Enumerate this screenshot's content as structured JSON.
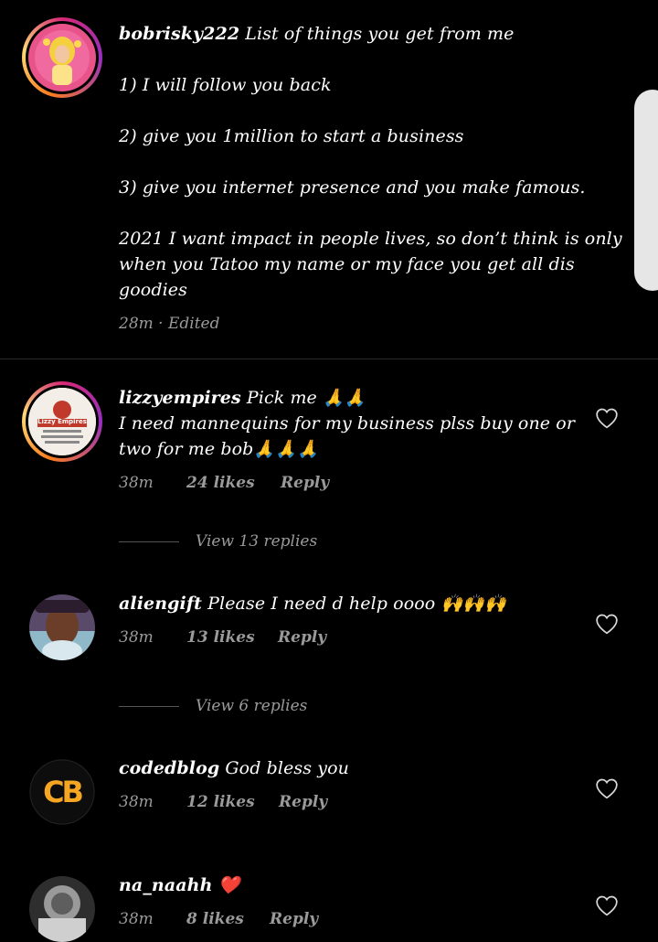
{
  "main_comment": {
    "username": "bobrisky222",
    "first_line": "List of things you get from me",
    "lines": [
      "1) I will follow you back",
      "2) give you 1million to start a business",
      "3) give you internet presence and you make famous.",
      "2021 I want impact in people lives, so don’t think is only",
      "when you Tatoo my name or my face you get all dis",
      "goodies"
    ],
    "meta": "28m · Edited"
  },
  "comments": [
    {
      "username": "lizzyempires",
      "text_line1": "Pick me 🙏🙏",
      "text_line2": "I need mannequins for my business plss buy one or",
      "text_line3": "two for me bob🙏🙏🙏",
      "time": "38m",
      "likes": "24 likes",
      "reply": "Reply",
      "view_replies": "View 13 replies",
      "avatar_text": "Lizzy Empires"
    },
    {
      "username": "aliengift",
      "text": "Please I need d help oooo 🙌🙌🙌",
      "time": "38m",
      "likes": "13 likes",
      "reply": "Reply",
      "view_replies": "View 6 replies"
    },
    {
      "username": "codedblog",
      "text": "God bless you",
      "time": "38m",
      "likes": "12 likes",
      "reply": "Reply",
      "avatar_text": "CB"
    },
    {
      "username": "na_naahh",
      "text": "❤️",
      "time": "38m",
      "likes": "8 likes",
      "reply": "Reply"
    }
  ],
  "colors": {
    "background": "#000000",
    "text": "#ffffff",
    "meta": "#9a9a9a",
    "avatar_ring": "#d62976",
    "codedblog_brand": "#f5a623"
  },
  "icons": [
    "heart-icon",
    "scroll-thumb"
  ]
}
